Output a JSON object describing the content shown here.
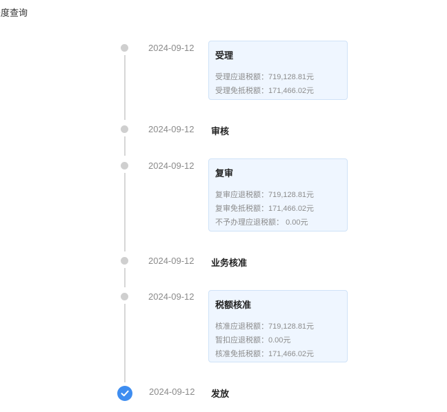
{
  "page": {
    "title": "进度查询"
  },
  "timeline": {
    "steps": [
      {
        "date": "2024-09-12",
        "title": "受理",
        "lines": [
          {
            "label": "受理应退税额：",
            "value": "719,128.81元"
          },
          {
            "label": "受理免抵税额：",
            "value": "171,466.02元"
          }
        ]
      },
      {
        "date": "2024-09-12",
        "title": "审核",
        "lines": []
      },
      {
        "date": "2024-09-12",
        "title": "复审",
        "lines": [
          {
            "label": "复审应退税额：",
            "value": "719,128.81元"
          },
          {
            "label": "复审免抵税额：",
            "value": "171,466.02元"
          },
          {
            "label": "不予办理应退税额：",
            "value": "0.00元"
          }
        ]
      },
      {
        "date": "2024-09-12",
        "title": "业务核准",
        "lines": []
      },
      {
        "date": "2024-09-12",
        "title": "税额核准",
        "lines": [
          {
            "label": "核准应退税额：",
            "value": "719,128.81元"
          },
          {
            "label": "暂扣应退税额：",
            "value": "0.00元"
          },
          {
            "label": "核准免抵税额：",
            "value": "171,466.02元"
          }
        ]
      },
      {
        "date": "2024-09-12",
        "title": "发放",
        "lines": []
      }
    ]
  },
  "colors": {
    "accent": "#3e8df0",
    "card_bg": "#eff6ff",
    "card_border": "#cfe2f7",
    "dot": "#cfcfcf"
  },
  "icons": {
    "final_status": "check-icon"
  }
}
